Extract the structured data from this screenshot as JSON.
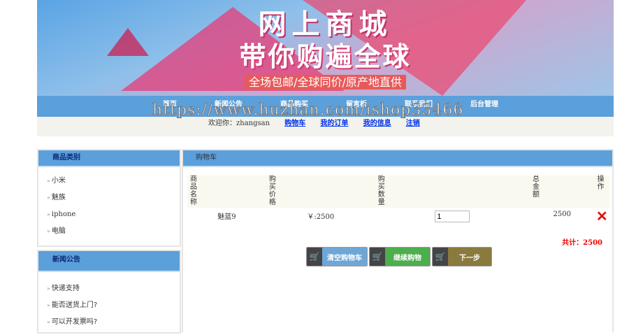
{
  "banner": {
    "title": "网上商城",
    "slogan": "带你购遍全球",
    "tagline": "全场包邮/全球同价/原产地直供"
  },
  "nav": [
    "首页",
    "新闻公告",
    "商品购买",
    "留言板",
    "联系我们",
    "后台管理"
  ],
  "welcome": {
    "text": "欢迎你：zhangsan",
    "links": [
      "购物车",
      "我的订单",
      "我的信息",
      "注销"
    ]
  },
  "watermark": "https://www.huzhan.com/ishop33466",
  "categories": {
    "title": "商品类别",
    "items": [
      "小米",
      "魅族",
      "iphone",
      "电脑"
    ]
  },
  "news": {
    "title": "新闻公告",
    "items": [
      "快递支持",
      "能否送货上门?",
      "可以开发票吗?"
    ]
  },
  "cart": {
    "title": "购物车",
    "headers": [
      "商品名称",
      "购买价格",
      "购买数量",
      "总金额",
      "操作"
    ],
    "rows": [
      {
        "name": "魅蓝9",
        "price": "￥:2500",
        "qty": "1",
        "total": "2500"
      }
    ],
    "sum": "共计：2500",
    "buttons": [
      "清空购物车",
      "继续购物",
      "下一步"
    ],
    "colors": {
      "clear": "#6fa6d6",
      "continue": "#4cae4c",
      "next": "#8a7a3e"
    }
  }
}
